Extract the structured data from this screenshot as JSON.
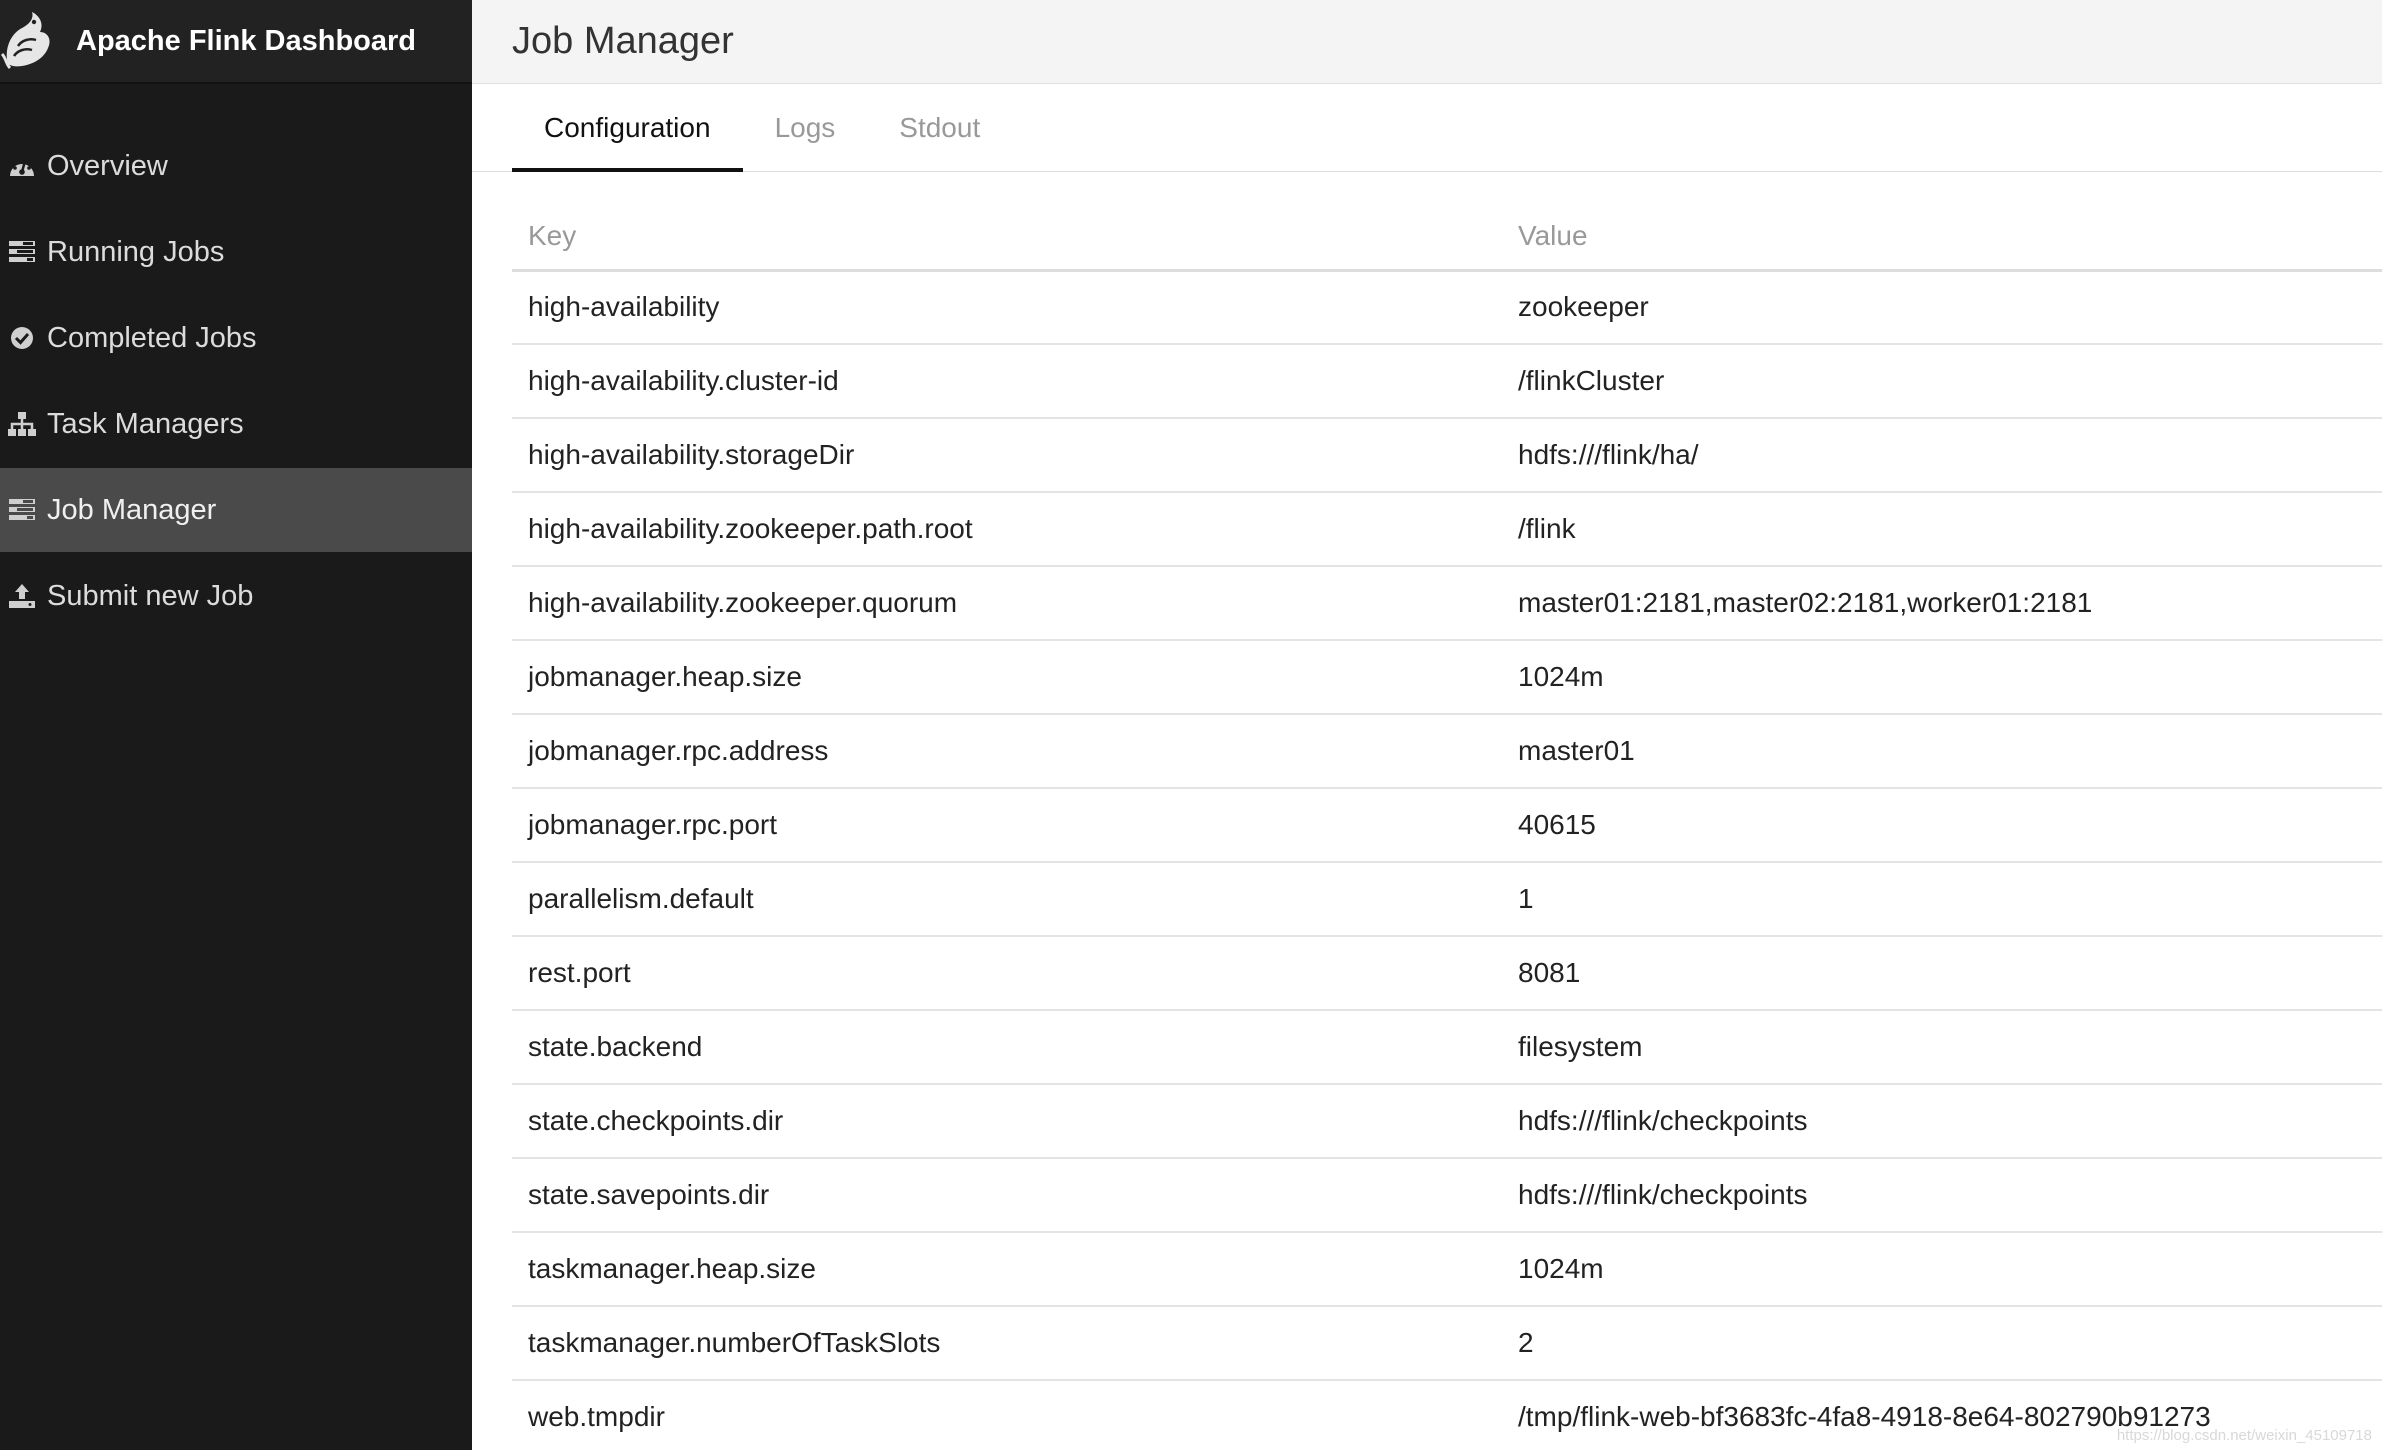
{
  "app": {
    "title": "Apache Flink Dashboard"
  },
  "sidebar": {
    "items": [
      {
        "label": "Overview",
        "icon": "dashboard-icon",
        "active": false
      },
      {
        "label": "Running Jobs",
        "icon": "tasks-icon",
        "active": false
      },
      {
        "label": "Completed Jobs",
        "icon": "check-circle-icon",
        "active": false
      },
      {
        "label": "Task Managers",
        "icon": "sitemap-icon",
        "active": false
      },
      {
        "label": "Job Manager",
        "icon": "tasks-icon",
        "active": true
      },
      {
        "label": "Submit new Job",
        "icon": "upload-icon",
        "active": false
      }
    ]
  },
  "header": {
    "title": "Job Manager"
  },
  "tabs": [
    {
      "label": "Configuration",
      "active": true
    },
    {
      "label": "Logs",
      "active": false
    },
    {
      "label": "Stdout",
      "active": false
    }
  ],
  "table": {
    "columns": {
      "key": "Key",
      "value": "Value"
    },
    "rows": [
      {
        "key": "high-availability",
        "value": "zookeeper"
      },
      {
        "key": "high-availability.cluster-id",
        "value": "/flinkCluster"
      },
      {
        "key": "high-availability.storageDir",
        "value": "hdfs:///flink/ha/"
      },
      {
        "key": "high-availability.zookeeper.path.root",
        "value": "/flink"
      },
      {
        "key": "high-availability.zookeeper.quorum",
        "value": "master01:2181,master02:2181,worker01:2181"
      },
      {
        "key": "jobmanager.heap.size",
        "value": "1024m"
      },
      {
        "key": "jobmanager.rpc.address",
        "value": "master01"
      },
      {
        "key": "jobmanager.rpc.port",
        "value": "40615"
      },
      {
        "key": "parallelism.default",
        "value": "1"
      },
      {
        "key": "rest.port",
        "value": "8081"
      },
      {
        "key": "state.backend",
        "value": "filesystem"
      },
      {
        "key": "state.checkpoints.dir",
        "value": "hdfs:///flink/checkpoints"
      },
      {
        "key": "state.savepoints.dir",
        "value": "hdfs:///flink/checkpoints"
      },
      {
        "key": "taskmanager.heap.size",
        "value": "1024m"
      },
      {
        "key": "taskmanager.numberOfTaskSlots",
        "value": "2"
      },
      {
        "key": "web.tmpdir",
        "value": "/tmp/flink-web-bf3683fc-4fa8-4918-8e64-802790b91273"
      }
    ]
  },
  "watermark": "https://blog.csdn.net/weixin_45109718",
  "colors": {
    "sidebar_bg": "#1a1a1a",
    "sidebar_active": "#4a4a4a",
    "header_bg": "#f4f4f4"
  }
}
